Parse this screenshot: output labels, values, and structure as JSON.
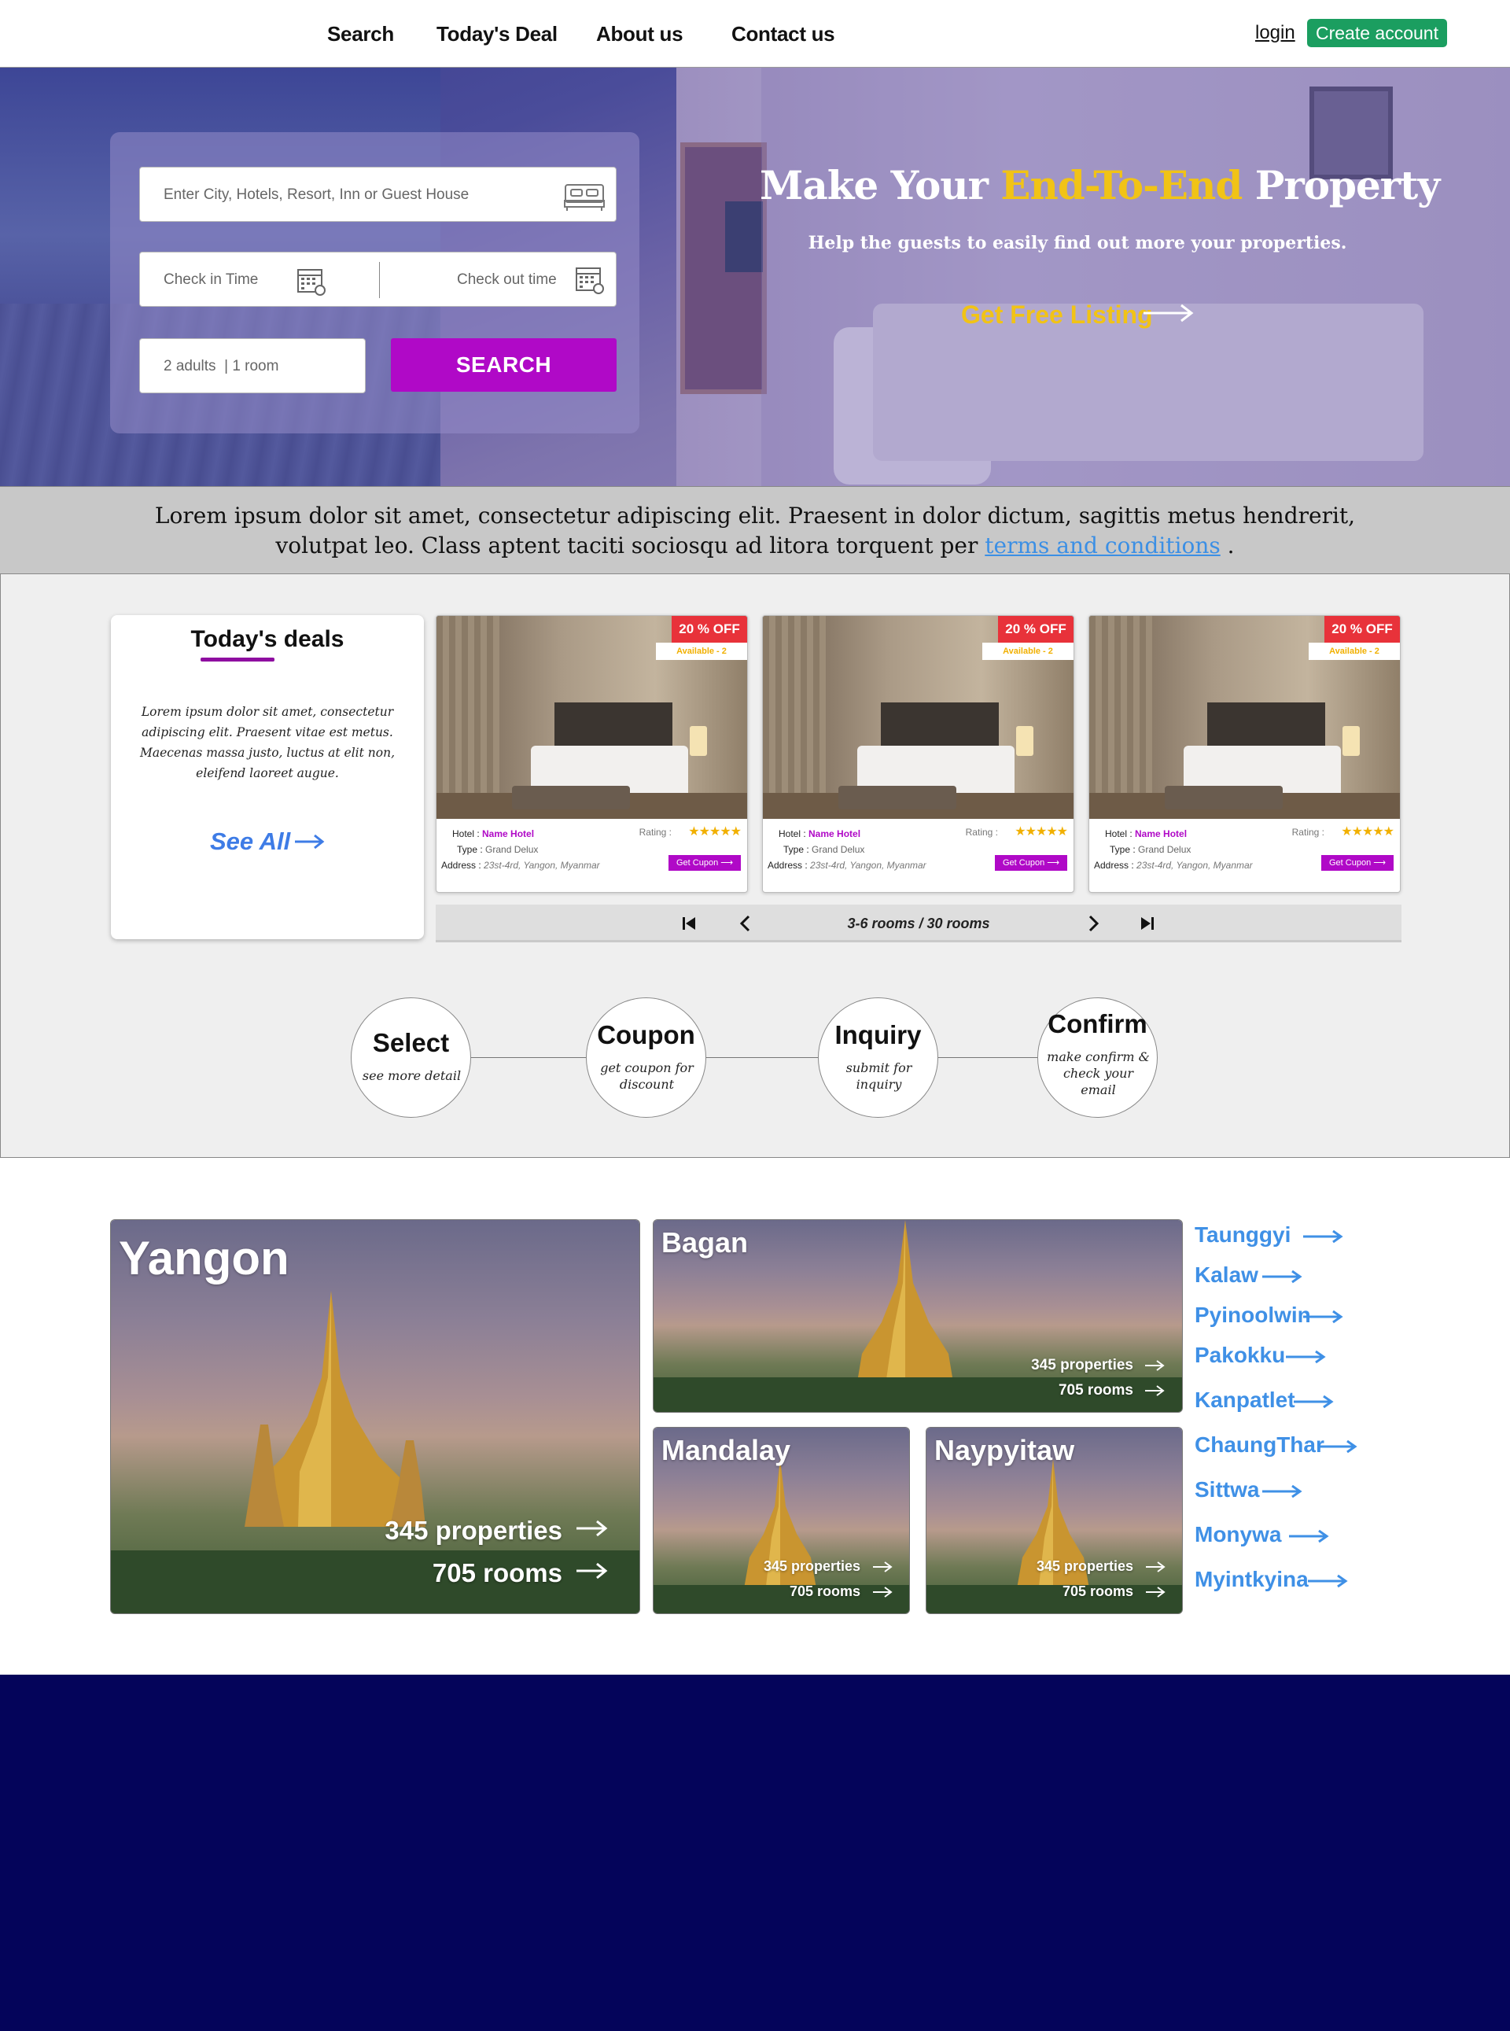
{
  "nav": {
    "links": [
      "Search",
      "Today's Deal",
      "About us",
      "Contact us"
    ],
    "login": "login",
    "create_account": "Create account"
  },
  "hero": {
    "search_placeholder": "Enter City, Hotels, Resort, Inn or Guest House",
    "check_in": "Check in Time",
    "check_out": "Check out time",
    "guests": "2 adults  | 1 room",
    "search_button": "SEARCH",
    "title_part1": "Make Your ",
    "title_highlight": "End-To-End",
    "title_part2": " Property",
    "subtitle": "Help the guests to easily find out more your properties.",
    "cta": "Get Free Listing",
    "accent_color": "#f1c316"
  },
  "info": {
    "text": "Lorem ipsum dolor sit amet, consectetur adipiscing elit. Praesent in dolor dictum, sagittis metus hendrerit, volutpat leo. Class aptent taciti sociosqu ad litora torquent per ",
    "link": "terms and conditions",
    "end": " ."
  },
  "deals": {
    "title": "Today's deals",
    "description": "Lorem ipsum dolor sit amet, consectetur adipiscing elit. Praesent vitae est metus. Maecenas massa justo, luctus at elit non, eleifend laoreet augue.",
    "see_all": "See All",
    "cards": [
      {
        "discount": "20 % OFF",
        "available": "Available - 2",
        "hotel_label": "Hotel : ",
        "hotel": "Name Hotel",
        "type_label": "Type : ",
        "type": "Grand Delux",
        "address_label": "Address : ",
        "address": "23st-4rd, Yangon, Myanmar",
        "rating_label": "Rating :",
        "stars": "★★★★★",
        "rating": 5,
        "coupon": "Get Cupon ⟶"
      },
      {
        "discount": "20 % OFF",
        "available": "Available - 2",
        "hotel_label": "Hotel : ",
        "hotel": "Name Hotel",
        "type_label": "Type : ",
        "type": "Grand Delux",
        "address_label": "Address : ",
        "address": "23st-4rd, Yangon, Myanmar",
        "rating_label": "Rating :",
        "stars": "★★★★★",
        "rating": 5,
        "coupon": "Get Cupon ⟶"
      },
      {
        "discount": "20 % OFF",
        "available": "Available - 2",
        "hotel_label": "Hotel : ",
        "hotel": "Name Hotel",
        "type_label": "Type : ",
        "type": "Grand Delux",
        "address_label": "Address : ",
        "address": "23st-4rd, Yangon, Myanmar",
        "rating_label": "Rating :",
        "stars": "★★★★★",
        "rating": 5,
        "coupon": "Get Cupon ⟶"
      }
    ],
    "pager": "3-6 rooms / 30 rooms"
  },
  "steps": [
    {
      "title": "Select",
      "desc": "see more detail"
    },
    {
      "title": "Coupon",
      "desc": "get coupon for discount"
    },
    {
      "title": "Inquiry",
      "desc": "submit for inquiry"
    },
    {
      "title": "Confirm",
      "desc": "make confirm & check your email"
    }
  ],
  "cities": {
    "main": [
      {
        "name": "Yangon",
        "properties": "345 properties",
        "rooms": "705 rooms"
      },
      {
        "name": "Bagan",
        "properties": "345 properties",
        "rooms": "705 rooms"
      },
      {
        "name": "Mandalay",
        "properties": "345 properties",
        "rooms": "705 rooms"
      },
      {
        "name": "Naypyitaw",
        "properties": "345 properties",
        "rooms": "705 rooms"
      }
    ],
    "side": [
      "Taunggyi",
      "Kalaw",
      "Pyinoolwin",
      "Pakokku",
      "Kanpatlet",
      "ChaungThar",
      "Sittwa",
      "Monywa",
      "Myintkyina"
    ],
    "link_color": "#3f90e6"
  },
  "colors": {
    "brand_purple": "#b009c7",
    "brand_green": "#1b9e60",
    "badge_red": "#e8323a",
    "footer_navy": "#04045a"
  }
}
